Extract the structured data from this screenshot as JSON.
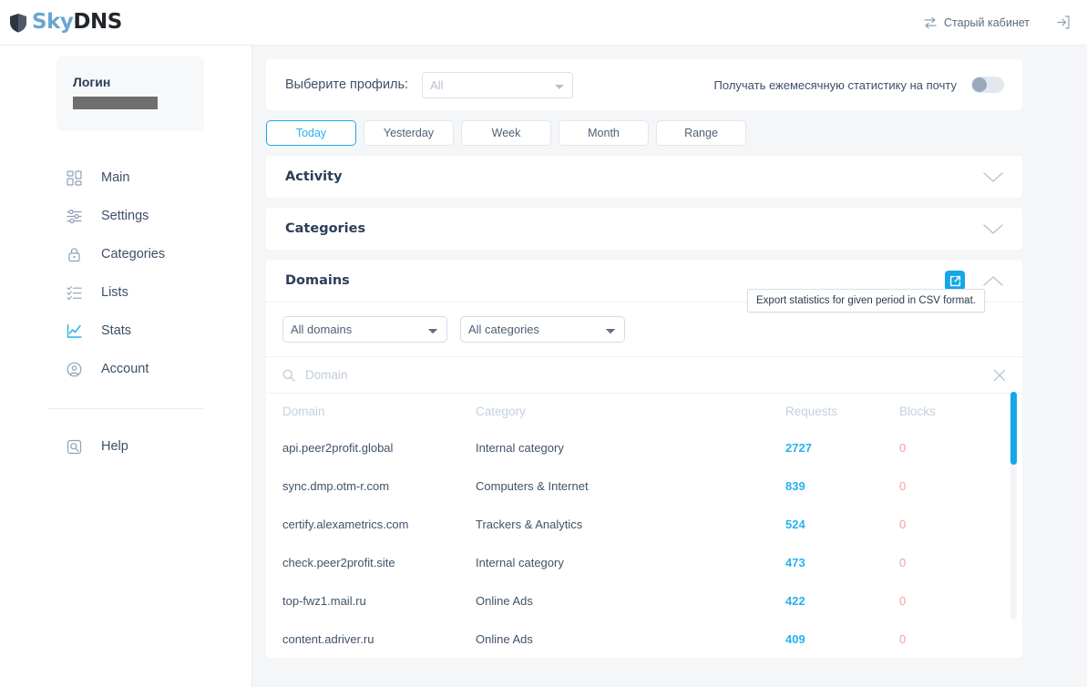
{
  "header": {
    "logo_sky": "Sky",
    "logo_dns": "DNS",
    "old_cabinet_label": "Старый кабинет",
    "icons": {
      "swap": "swap-arrows-icon",
      "logout": "logout-icon"
    }
  },
  "sidebar": {
    "login_label": "Логин",
    "login_value": "",
    "items": [
      {
        "label": "Main",
        "icon": "grid-icon",
        "active": false
      },
      {
        "label": "Settings",
        "icon": "sliders-icon",
        "active": false
      },
      {
        "label": "Categories",
        "icon": "lock-icon",
        "active": false
      },
      {
        "label": "Lists",
        "icon": "checklist-icon",
        "active": false
      },
      {
        "label": "Stats",
        "icon": "chart-line-icon",
        "active": true
      },
      {
        "label": "Account",
        "icon": "user-circle-icon",
        "active": false
      }
    ],
    "bottom_items": [
      {
        "label": "Help",
        "icon": "help-search-icon"
      }
    ]
  },
  "profile_bar": {
    "label": "Выберите профиль:",
    "select_value": "All",
    "select_options": [
      "All"
    ],
    "monthly_stats_label": "Получать ежемесячную статистику на почту",
    "toggle_state": "off"
  },
  "date_tabs": [
    {
      "label": "Today",
      "active": true
    },
    {
      "label": "Yesterday",
      "active": false
    },
    {
      "label": "Week",
      "active": false
    },
    {
      "label": "Month",
      "active": false
    },
    {
      "label": "Range",
      "active": false
    }
  ],
  "sections": {
    "activity": {
      "title": "Activity",
      "expanded": false
    },
    "categories": {
      "title": "Categories",
      "expanded": false
    },
    "domains": {
      "title": "Domains",
      "expanded": true,
      "export_icon": "external-link-icon",
      "tooltip": "Export statistics for given period in CSV format.",
      "filters": {
        "domains_value": "All domains",
        "domains_options": [
          "All domains"
        ],
        "categories_value": "All categories",
        "categories_options": [
          "All categories"
        ]
      },
      "search": {
        "placeholder": "Domain",
        "value": "",
        "search_icon": "search-icon",
        "clear_icon": "close-icon"
      },
      "table": {
        "columns": [
          "Domain",
          "Category",
          "Requests",
          "Blocks"
        ],
        "rows": [
          {
            "domain": "api.peer2profit.global",
            "category": "Internal category",
            "requests": "2727",
            "blocks": "0"
          },
          {
            "domain": "sync.dmp.otm-r.com",
            "category": "Computers & Internet",
            "requests": "839",
            "blocks": "0"
          },
          {
            "domain": "certify.alexametrics.com",
            "category": "Trackers & Analytics",
            "requests": "524",
            "blocks": "0"
          },
          {
            "domain": "check.peer2profit.site",
            "category": "Internal category",
            "requests": "473",
            "blocks": "0"
          },
          {
            "domain": "top-fwz1.mail.ru",
            "category": "Online Ads",
            "requests": "422",
            "blocks": "0"
          },
          {
            "domain": "content.adriver.ru",
            "category": "Online Ads",
            "requests": "409",
            "blocks": "0"
          }
        ]
      }
    }
  },
  "colors": {
    "accent_blue": "#15a7e8",
    "link_blue": "#29b2ef",
    "logo_blue": "#6aa6cf",
    "text_dark": "#2c3e58",
    "text_body": "#41526a",
    "muted": "#c6d0e0",
    "blocks_red": "#f5a0a0",
    "bg_gray": "#f5f6f8"
  }
}
